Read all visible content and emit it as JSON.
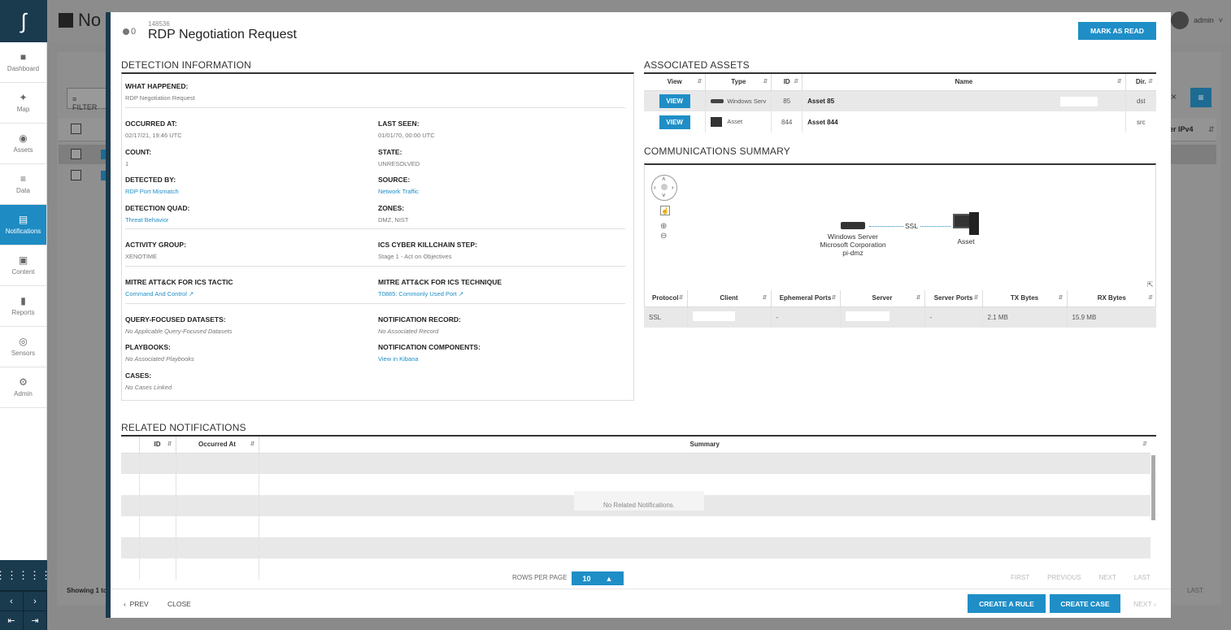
{
  "sidebar": {
    "items": [
      {
        "label": "Dashboard",
        "icon": "dashboard-icon",
        "glyph": "■"
      },
      {
        "label": "Map",
        "icon": "map-icon",
        "glyph": "✦"
      },
      {
        "label": "Assets",
        "icon": "assets-icon",
        "glyph": "◉"
      },
      {
        "label": "Data",
        "icon": "data-icon",
        "glyph": "≡"
      },
      {
        "label": "Notifications",
        "icon": "notifications-icon",
        "glyph": "▤"
      },
      {
        "label": "Content",
        "icon": "content-icon",
        "glyph": "▣"
      },
      {
        "label": "Reports",
        "icon": "reports-icon",
        "glyph": "▮"
      },
      {
        "label": "Sensors",
        "icon": "sensors-icon",
        "glyph": "◎"
      },
      {
        "label": "Admin",
        "icon": "admin-icon",
        "glyph": "⚙"
      }
    ]
  },
  "background": {
    "page_title": "No",
    "user": "admin",
    "filter": "FILTER",
    "column_ipv4": "er IPv4",
    "showing": "Showing 1 to",
    "last": "LAST"
  },
  "modal": {
    "id": "148536",
    "comment_count": "0",
    "title": "RDP Negotiation Request",
    "mark_read": "MARK AS READ",
    "detection": {
      "section_title": "DETECTION INFORMATION",
      "what_happened_label": "WHAT HAPPENED:",
      "what_happened": "RDP Negotiation Request",
      "occurred_label": "OCCURRED AT:",
      "occurred": "02/17/21, 19:46 UTC",
      "last_seen_label": "LAST SEEN:",
      "last_seen": "01/01/70, 00:00 UTC",
      "count_label": "COUNT:",
      "count": "1",
      "state_label": "STATE:",
      "state": "UNRESOLVED",
      "detected_by_label": "DETECTED BY:",
      "detected_by": "RDP Port Mismatch",
      "source_label": "SOURCE:",
      "source": "Network Traffic",
      "quad_label": "DETECTION QUAD:",
      "quad": "Threat Behavior",
      "zones_label": "ZONES:",
      "zones": "DMZ, NIST",
      "activity_label": "ACTIVITY GROUP:",
      "activity": "XENOTIME",
      "killchain_label": "ICS CYBER KILLCHAIN STEP:",
      "killchain": "Stage 1 - Act on Objectives",
      "tactic_label": "MITRE ATT&CK FOR ICS TACTIC",
      "tactic": "Command And Control",
      "technique_label": "MITRE ATT&CK FOR ICS TECHNIQUE",
      "technique": "T0885: Commonly Used Port",
      "qfd_label": "QUERY-FOCUSED DATASETS:",
      "qfd": "No Applicable Query-Focused Datasets",
      "record_label": "NOTIFICATION RECORD:",
      "record": "No Associated Record",
      "playbooks_label": "PLAYBOOKS:",
      "playbooks": "No Associated Playbooks",
      "components_label": "NOTIFICATION COMPONENTS:",
      "components": "View in Kibana",
      "cases_label": "CASES:",
      "cases": "No Cases Linked"
    },
    "assets": {
      "section_title": "ASSOCIATED ASSETS",
      "headers": [
        "View",
        "Type",
        "ID",
        "Name",
        "Dir."
      ],
      "rows": [
        {
          "view": "VIEW",
          "type": "Windows Serv",
          "id": "85",
          "name": "Asset 85",
          "dir": "dst"
        },
        {
          "view": "VIEW",
          "type": "Asset",
          "id": "844",
          "name": "Asset 844",
          "dir": "src"
        }
      ]
    },
    "comm": {
      "section_title": "COMMUNICATIONS SUMMARY",
      "node_left": [
        "Windows Server",
        "Microsoft Corporation",
        "pi-dmz"
      ],
      "node_right": "Asset",
      "link_label": "SSL",
      "headers": [
        "Protocol",
        "Client",
        "Ephemeral Ports",
        "Server",
        "Server Ports",
        "TX Bytes",
        "RX Bytes"
      ],
      "row": {
        "protocol": "SSL",
        "eph": "-",
        "sports": "-",
        "tx": "2.1 MB",
        "rx": "15.9 MB"
      }
    },
    "related": {
      "section_title": "RELATED NOTIFICATIONS",
      "headers": [
        "ID",
        "Occurred At",
        "Summary"
      ],
      "empty": "No Related Notifications.",
      "rows_per_page_label": "ROWS PER PAGE",
      "rows_per_page": "10",
      "pager": [
        "FIRST",
        "PREVIOUS",
        "NEXT",
        "LAST"
      ]
    },
    "footer": {
      "prev": "PREV",
      "close": "CLOSE",
      "create_rule": "CREATE A RULE",
      "create_case": "CREATE CASE",
      "next": "NEXT"
    }
  }
}
